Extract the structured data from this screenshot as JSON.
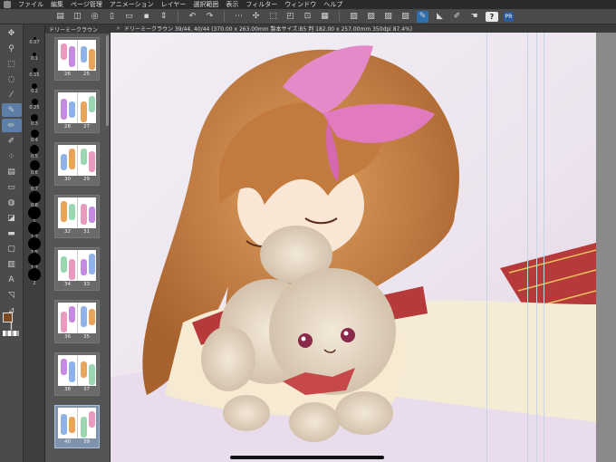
{
  "menubar": {
    "items": [
      {
        "label": "ファイル"
      },
      {
        "label": "編集"
      },
      {
        "label": "ページ管理"
      },
      {
        "label": "アニメーション"
      },
      {
        "label": "レイヤー"
      },
      {
        "label": "選択範囲"
      },
      {
        "label": "表示"
      },
      {
        "label": "フィルター"
      },
      {
        "label": "ウィンドウ"
      },
      {
        "label": "ヘルプ"
      }
    ]
  },
  "commandbar": {
    "help_label": "?",
    "pr_label": "PR"
  },
  "colors": {
    "main_color": "#7a4a24",
    "sub_color": "#ffffff",
    "accent": "#2f6fae"
  },
  "brush_sizes": [
    "0.07",
    "0.1",
    "0.15",
    "0.2",
    "0.25",
    "0.3",
    "0.4",
    "0.5",
    "0.6",
    "0.7",
    "0.8",
    "1",
    "1.2",
    "1.5",
    "1.7",
    "2"
  ],
  "page_panel": {
    "tab_label": "ドリーミークラウン",
    "spreads": [
      {
        "left": "26",
        "right": "25",
        "selected": false
      },
      {
        "left": "28",
        "right": "27",
        "selected": false
      },
      {
        "left": "30",
        "right": "29",
        "selected": false
      },
      {
        "left": "32",
        "right": "31",
        "selected": false
      },
      {
        "left": "34",
        "right": "33",
        "selected": false
      },
      {
        "left": "36",
        "right": "35",
        "selected": false
      },
      {
        "left": "38",
        "right": "37",
        "selected": false
      },
      {
        "left": "40",
        "right": "39",
        "selected": true
      }
    ]
  },
  "canvas_tab": {
    "title": "ドリーミークラウン 39/44, 40/44 (370.00 x 263.00mm 製本サイズ:B5 判 182.00 x 257.00mm 350dpi 87.4%)"
  }
}
